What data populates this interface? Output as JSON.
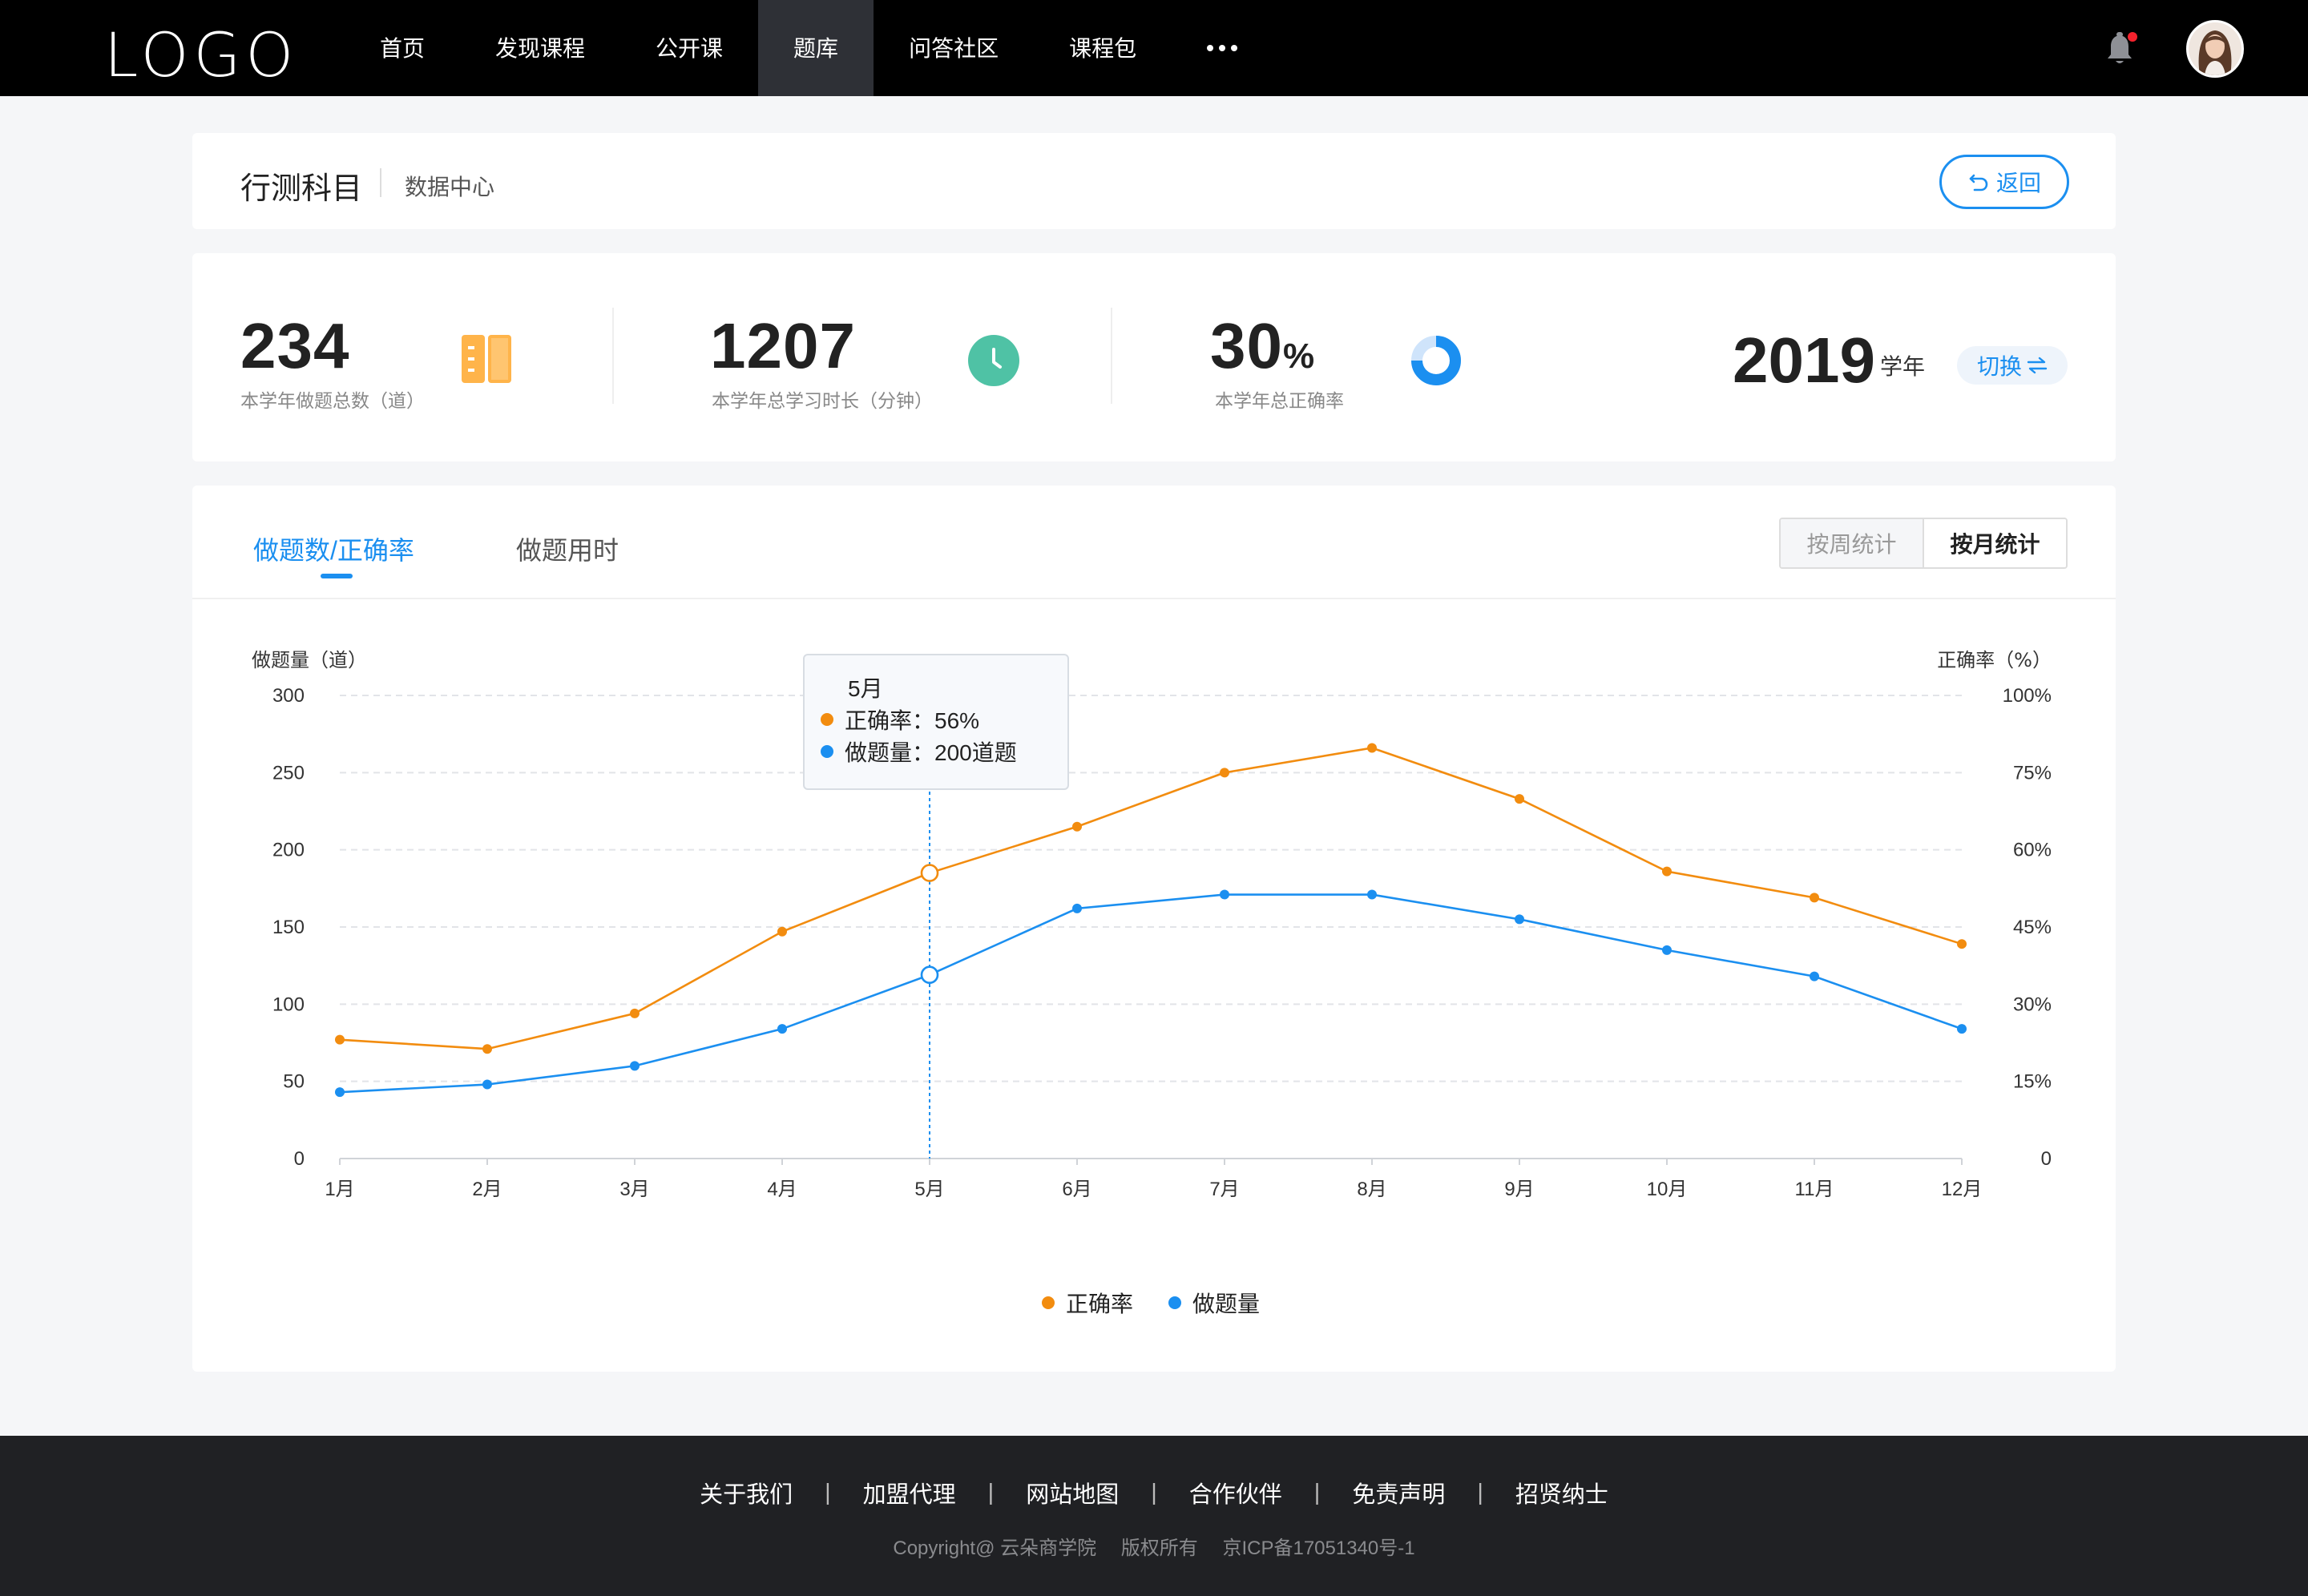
{
  "nav": {
    "logo": "LOGO",
    "items": [
      "首页",
      "发现课程",
      "公开课",
      "题库",
      "问答社区",
      "课程包"
    ],
    "active_index": 3
  },
  "header": {
    "title": "行测科目",
    "subtitle": "数据中心",
    "back_label": "返回"
  },
  "stats": {
    "total_questions": "234",
    "total_questions_label": "本学年做题总数（道）",
    "study_minutes": "1207",
    "study_minutes_label": "本学年总学习时长（分钟）",
    "accuracy": "30",
    "accuracy_unit": "%",
    "accuracy_label": "本学年总正确率",
    "year": "2019",
    "year_unit": "学年",
    "switch_label": "切换"
  },
  "chart_panel": {
    "tabs": [
      "做题数/正确率",
      "做题用时"
    ],
    "segments": [
      "按周统计",
      "按月统计"
    ],
    "selected_segment": 1
  },
  "tooltip": {
    "title": "5月",
    "accuracy_line": "正确率：56%",
    "count_line": "做题量：200道题"
  },
  "chart_data": {
    "type": "line",
    "categories": [
      "1月",
      "2月",
      "3月",
      "4月",
      "5月",
      "6月",
      "7月",
      "8月",
      "9月",
      "10月",
      "11月",
      "12月"
    ],
    "ylabel_left": "做题量（道）",
    "ylabel_right": "正确率（%）",
    "yticks_left": [
      "300",
      "250",
      "200",
      "150",
      "100",
      "50",
      "0"
    ],
    "yticks_right": [
      "100%",
      "75%",
      "60%",
      "45%",
      "30%",
      "15%",
      "0"
    ],
    "ylim": [
      0,
      300
    ],
    "series": [
      {
        "name": "正确率",
        "color": "#f28c0f",
        "values": [
          77,
          71,
          94,
          147,
          185,
          215,
          250,
          266,
          233,
          186,
          169,
          139
        ]
      },
      {
        "name": "做题量",
        "color": "#1b8ff0",
        "values": [
          43,
          48,
          60,
          84,
          119,
          162,
          171,
          171,
          155,
          135,
          118,
          84
        ]
      }
    ],
    "highlight_index": 4,
    "grid": true,
    "legend": "bottom-center"
  },
  "footer": {
    "links": [
      "关于我们",
      "加盟代理",
      "网站地图",
      "合作伙伴",
      "免责声明",
      "招贤纳士"
    ],
    "separator": "|",
    "copyright": "Copyright@ 云朵商学院",
    "rights": "版权所有",
    "icp": "京ICP备17051340号-1"
  }
}
